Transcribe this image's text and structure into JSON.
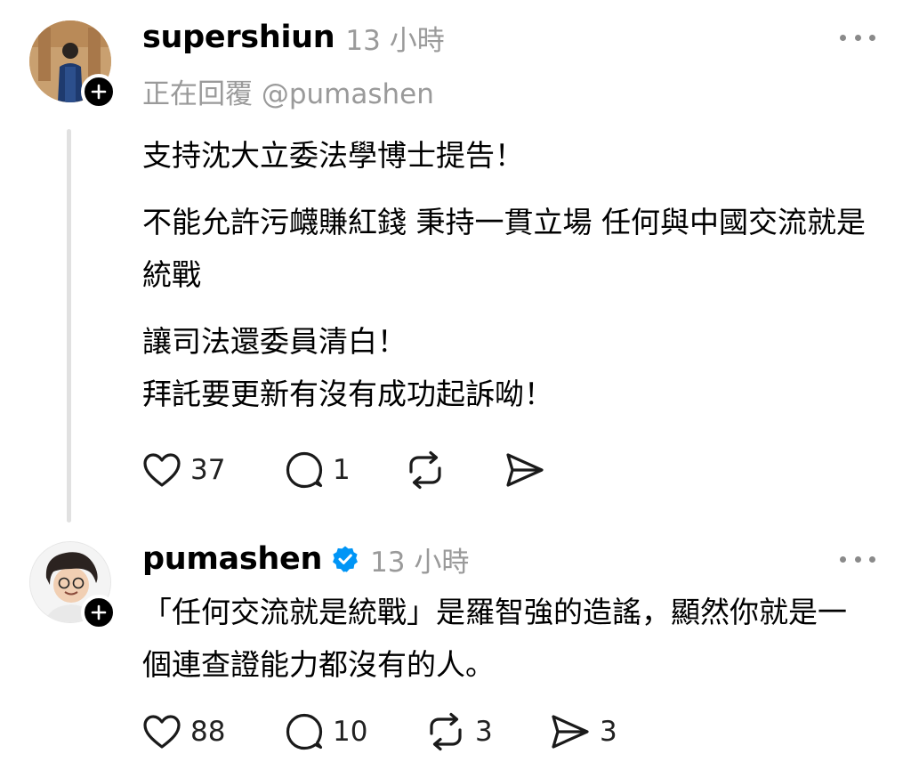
{
  "posts": [
    {
      "username": "supershiun",
      "time": "13 小時",
      "reply_to": "正在回覆 @pumashen",
      "paragraphs": [
        [
          "支持沈大立委法學博士提告！"
        ],
        [
          "不能允許污衊賺紅錢 秉持一貫立場 任何與中國交流就是統戰"
        ],
        [
          "讓司法還委員清白！",
          "拜託要更新有沒有成功起訴呦！"
        ]
      ],
      "likes": "37",
      "replies": "1",
      "reposts": "",
      "shares": ""
    },
    {
      "username": "pumashen",
      "time": "13 小時",
      "paragraphs": [
        [
          "「任何交流就是統戰」是羅智強的造謠，顯然你就是一個連查證能力都沒有的人。"
        ]
      ],
      "likes": "88",
      "replies": "10",
      "reposts": "3",
      "shares": "3"
    }
  ],
  "icons": {
    "like": "heart-icon",
    "reply": "comment-icon",
    "repost": "repost-icon",
    "share": "send-icon",
    "more": "more-icon",
    "follow": "plus-icon",
    "verified": "verified-badge-icon"
  },
  "colors": {
    "text": "#000000",
    "muted": "#9a9a9a",
    "verified": "#0095f6",
    "thread_line": "#e1e1e1"
  }
}
